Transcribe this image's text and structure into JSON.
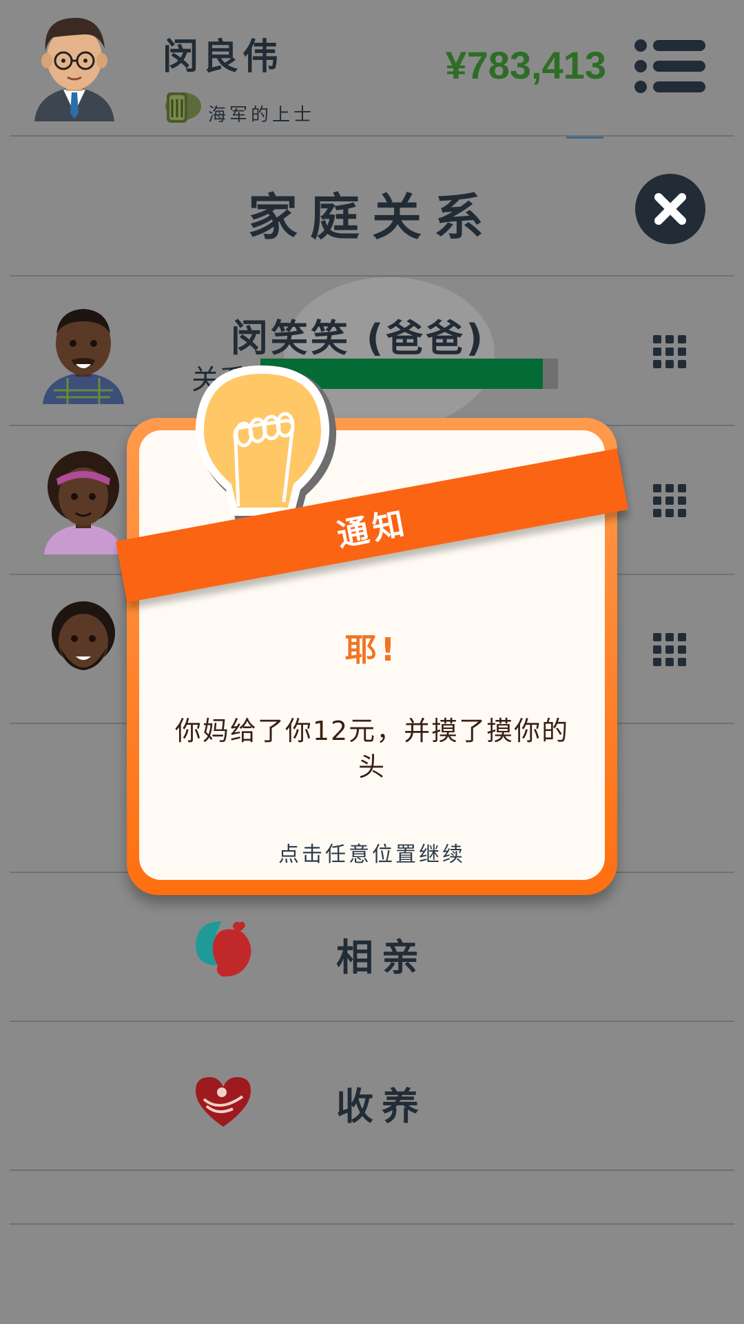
{
  "header": {
    "player_name": "闵良伟",
    "rank": "海军的上士",
    "money": "¥783,413"
  },
  "section": {
    "title": "家庭关系"
  },
  "family": [
    {
      "name": "闵笑笑 (爸爸)",
      "relation_label": "关系",
      "relation_level": 0.95
    },
    {
      "name": "",
      "relation_label": "",
      "relation_level": null
    },
    {
      "name": "",
      "relation_label": "",
      "relation_level": null
    }
  ],
  "actions": [
    {
      "label": "相亲",
      "icon": "dating-icon"
    },
    {
      "label": "收养",
      "icon": "adoption-heart-icon"
    }
  ],
  "modal": {
    "banner": "通知",
    "heading": "耶!",
    "message": "你妈给了你12元，并摸了摸你的头",
    "hint": "点击任意位置继续"
  },
  "colors": {
    "money": "#2e6d26",
    "relation_bar": "#056b35",
    "banner": "#fb6413",
    "modal_border": "#ff7a1a",
    "heading": "#f07523",
    "ink": "#222c36"
  }
}
